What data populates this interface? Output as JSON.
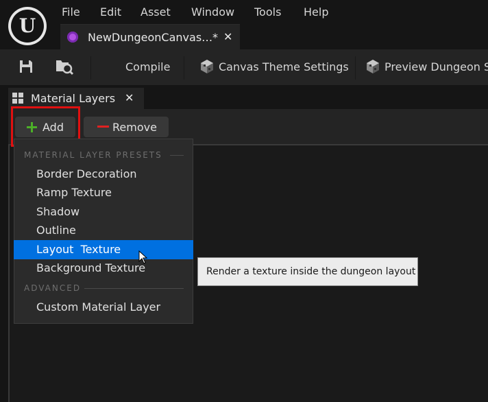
{
  "menu": [
    "File",
    "Edit",
    "Asset",
    "Window",
    "Tools",
    "Help"
  ],
  "document_tab": {
    "title": "NewDungeonCanvas…",
    "dirty_marker": "*",
    "close": "✕"
  },
  "toolbar": {
    "compile": "Compile",
    "canvas_theme": "Canvas Theme Settings",
    "preview": "Preview Dungeon S"
  },
  "panel": {
    "title": "Material Layers",
    "close": "✕"
  },
  "buttons": {
    "add": "Add",
    "remove": "Remove"
  },
  "dropdown": {
    "presets_title": "MATERIAL LAYER PRESETS",
    "presets": [
      "Border Decoration",
      "Ramp Texture",
      "Shadow",
      "Outline",
      "Layout  Texture",
      "Background Texture"
    ],
    "selected_index": 4,
    "advanced_title": "ADVANCED",
    "advanced": [
      "Custom Material Layer"
    ]
  },
  "tooltip": "Render a texture inside the dungeon layout",
  "colors": {
    "selection": "#0070e0",
    "highlight_box": "#e01010",
    "add_icon": "#4caf28",
    "remove_icon": "#e02020"
  }
}
